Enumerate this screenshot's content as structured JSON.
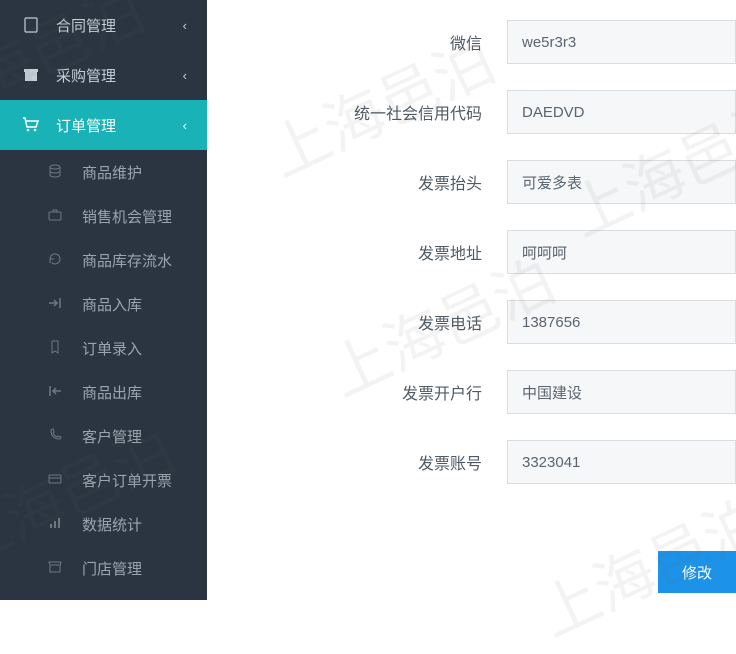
{
  "watermark": "上海邑泊",
  "sidebar": {
    "top": [
      {
        "label": "合同管理",
        "icon": "document-icon"
      },
      {
        "label": "采购管理",
        "icon": "box-icon"
      }
    ],
    "active": {
      "label": "订单管理",
      "icon": "cart-icon"
    },
    "sub": [
      {
        "label": "商品维护",
        "icon": "database-icon"
      },
      {
        "label": "销售机会管理",
        "icon": "briefcase-icon"
      },
      {
        "label": "商品库存流水",
        "icon": "history-icon"
      },
      {
        "label": "商品入库",
        "icon": "arrow-in-icon"
      },
      {
        "label": "订单录入",
        "icon": "bookmark-icon"
      },
      {
        "label": "商品出库",
        "icon": "arrow-out-icon"
      },
      {
        "label": "客户管理",
        "icon": "phone-icon"
      },
      {
        "label": "客户订单开票",
        "icon": "card-icon"
      },
      {
        "label": "数据统计",
        "icon": "chart-icon"
      },
      {
        "label": "门店管理",
        "icon": "store-icon"
      }
    ]
  },
  "form": {
    "fields": [
      {
        "label": "微信",
        "value": "we5r3r3"
      },
      {
        "label": "统一社会信用代码",
        "value": "DAEDVD"
      },
      {
        "label": "发票抬头",
        "value": "可爱多表"
      },
      {
        "label": "发票地址",
        "value": "呵呵呵"
      },
      {
        "label": "发票电话",
        "value": "1387656"
      },
      {
        "label": "发票开户行",
        "value": "中国建设"
      },
      {
        "label": "发票账号",
        "value": "3323041"
      }
    ],
    "submit_label": "修改"
  }
}
